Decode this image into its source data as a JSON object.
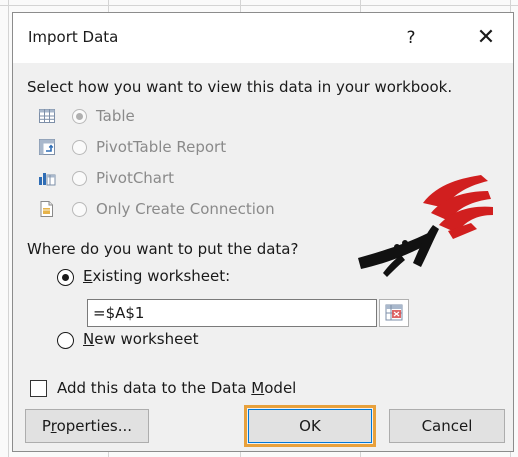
{
  "dialog": {
    "title": "Import Data",
    "help_label": "?",
    "close_label": "✕"
  },
  "view_section": {
    "prompt": "Select how you want to view this data in your workbook.",
    "options": [
      {
        "label": "Table",
        "selected": true,
        "enabled": false,
        "icon": "table-icon"
      },
      {
        "label": "PivotTable Report",
        "selected": false,
        "enabled": false,
        "icon": "pivottable-icon"
      },
      {
        "label": "PivotChart",
        "selected": false,
        "enabled": false,
        "icon": "pivotchart-icon"
      },
      {
        "label": "Only Create Connection",
        "selected": false,
        "enabled": false,
        "icon": "connection-icon"
      }
    ]
  },
  "location_section": {
    "prompt": "Where do you want to put the data?",
    "existing": {
      "label_first": "E",
      "label_rest": "xisting worksheet:",
      "selected": true
    },
    "reference_value": "=$A$1",
    "new": {
      "label_first": "N",
      "label_rest": "ew worksheet",
      "selected": false
    }
  },
  "data_model": {
    "label_pre": "Add this data to the Data ",
    "label_u": "M",
    "label_post": "odel",
    "checked": false
  },
  "buttons": {
    "properties": {
      "pre": "P",
      "u": "r",
      "post": "operties..."
    },
    "ok": "OK",
    "cancel": "Cancel"
  },
  "colors": {
    "focus_outline": "#e8a13c",
    "watermark_red": "#d11f1f",
    "watermark_black": "#111111"
  }
}
